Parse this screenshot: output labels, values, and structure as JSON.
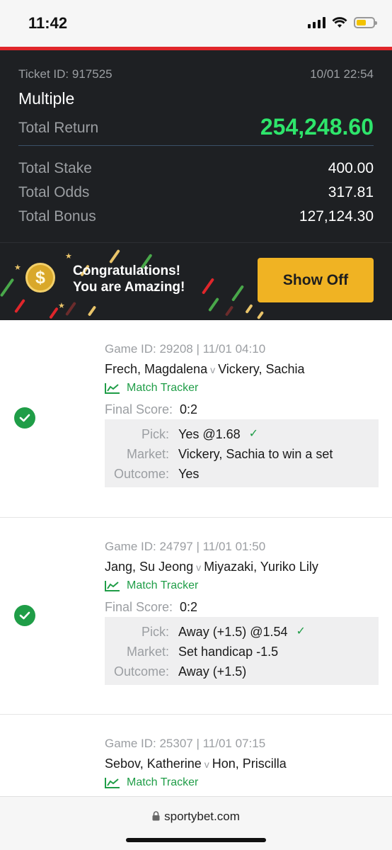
{
  "status_bar": {
    "time": "11:42",
    "battery_level": 0.6
  },
  "ticket": {
    "id_label": "Ticket ID: 917525",
    "date": "10/01 22:54",
    "type": "Multiple",
    "total_return_label": "Total Return",
    "total_return": "254,248.60",
    "rows": [
      {
        "label": "Total Stake",
        "value": "400.00"
      },
      {
        "label": "Total Odds",
        "value": "317.81"
      },
      {
        "label": "Total Bonus",
        "value": "127,124.30"
      }
    ],
    "return_color": "#2ee56b"
  },
  "banner": {
    "line1": "Congratulations!",
    "line2": "You are Amazing!",
    "button_label": "Show Off",
    "coin_symbol": "$",
    "button_color": "#f0b323"
  },
  "games": [
    {
      "game_id": "Game ID: 29208 | 11/01 04:10",
      "home": "Frech, Magdalena",
      "vs": "v",
      "away": "Vickery, Sachia",
      "tracker_label": "Match Tracker",
      "final_score_label": "Final Score:",
      "final_score": "0:2",
      "pick_label": "Pick:",
      "pick": "Yes @1.68",
      "market_label": "Market:",
      "market": "Vickery, Sachia to win a set",
      "outcome_label": "Outcome:",
      "outcome": "Yes",
      "status_icon": "check-circle-icon"
    },
    {
      "game_id": "Game ID: 24797 | 11/01 01:50",
      "home": "Jang, Su Jeong",
      "vs": "v",
      "away": "Miyazaki, Yuriko Lily",
      "tracker_label": "Match Tracker",
      "final_score_label": "Final Score:",
      "final_score": "0:2",
      "pick_label": "Pick:",
      "pick": "Away (+1.5) @1.54",
      "market_label": "Market:",
      "market": "Set handicap -1.5",
      "outcome_label": "Outcome:",
      "outcome": "Away (+1.5)",
      "status_icon": "check-circle-icon"
    },
    {
      "game_id": "Game ID: 25307 | 11/01 07:15",
      "home": "Sebov, Katherine",
      "vs": "v",
      "away": "Hon, Priscilla",
      "tracker_label": "Match Tracker"
    }
  ],
  "browser": {
    "url": "sportybet.com"
  },
  "colors": {
    "accent_green": "#1f9d47",
    "header_bg": "#1e2023",
    "red_line": "#e0262b"
  }
}
